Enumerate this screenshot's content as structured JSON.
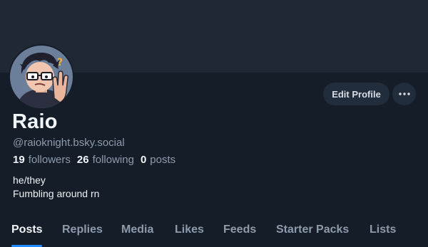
{
  "profile": {
    "display_name": "Raio",
    "handle": "@raioknight.bsky.social",
    "bio_lines": [
      "he/they",
      "Fumbling around rn"
    ],
    "avatar_icon": "avatar-illustration"
  },
  "stats": {
    "followers": {
      "count": "19",
      "label": "followers"
    },
    "following": {
      "count": "26",
      "label": "following"
    },
    "posts": {
      "count": "0",
      "label": "posts"
    }
  },
  "actions": {
    "edit_profile_label": "Edit Profile",
    "more_icon": "ellipsis-icon"
  },
  "tabs": [
    {
      "label": "Posts",
      "active": true
    },
    {
      "label": "Replies",
      "active": false
    },
    {
      "label": "Media",
      "active": false
    },
    {
      "label": "Likes",
      "active": false
    },
    {
      "label": "Feeds",
      "active": false
    },
    {
      "label": "Starter Packs",
      "active": false
    },
    {
      "label": "Lists",
      "active": false
    }
  ],
  "colors": {
    "background": "#151d28",
    "banner": "#1e2935",
    "accent": "#208bfe",
    "muted_text": "#8d9bab"
  }
}
